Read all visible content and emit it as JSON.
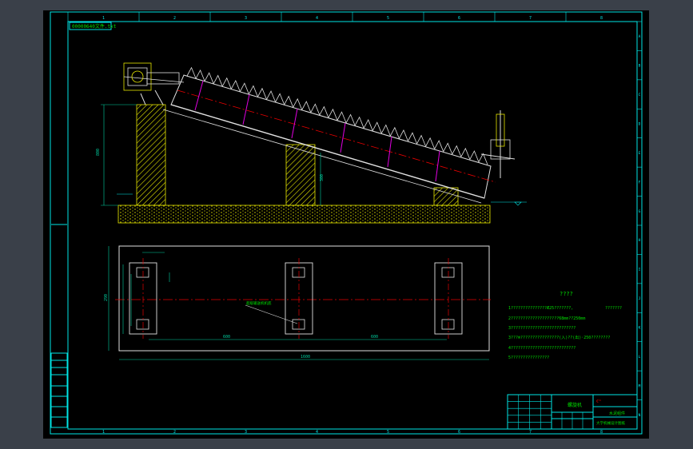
{
  "drawing": {
    "title_label": "00000640文件.txt",
    "notes_heading": "????",
    "notes": [
      "1???????????????Æ25???????,",
      "2????????????????????68mm??250mm",
      "3???????????????????????????",
      "3???®????????????????(入)??(出)·250????????",
      "4???????????????????????????",
      "5????????????????"
    ],
    "notes_right": "???????",
    "section_label": "超级输送机机底",
    "dim_base_length": "1600",
    "dim_span_a": "600",
    "dim_span_b": "600",
    "dim_side": "290",
    "dim_column_height": "800",
    "dim_right_height": "300"
  },
  "title_block": {
    "name": "螺旋机",
    "material": "水泥组件",
    "school": "大学机械设计图纸",
    "mark": "€™"
  },
  "zone_numbers": {
    "top": [
      "1",
      "2",
      "3",
      "4",
      "5",
      "6",
      "7",
      "8"
    ],
    "right": [
      "A",
      "B",
      "C",
      "D",
      "E",
      "F",
      "G",
      "H",
      "I",
      "J",
      "K",
      "L",
      "M",
      "N"
    ]
  },
  "colors": {
    "frame": "#00e5e5",
    "concrete_hatch": "#e6e600",
    "centerline": "#e60000",
    "auger": "#e0e0e0",
    "rib": "#e000e0",
    "text": "#00e000",
    "dimension": "#00d0a0"
  }
}
